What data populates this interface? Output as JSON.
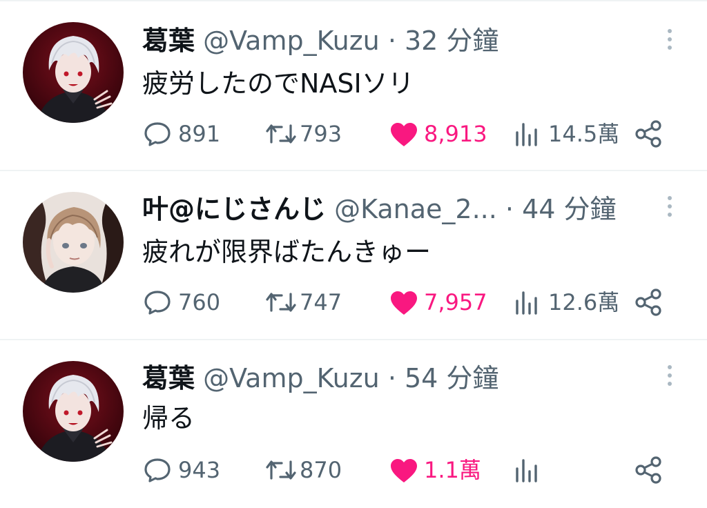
{
  "colors": {
    "like": "#f91880",
    "secondary": "#536471",
    "text": "#0f1419",
    "divider": "#eff3f4"
  },
  "tweets": [
    {
      "display_name": "葛葉",
      "handle": "@Vamp_Kuzu",
      "separator": "·",
      "time": "32 分鐘",
      "text": "疲労したのでNASIソリ",
      "replies": "891",
      "retweets": "793",
      "likes": "8,913",
      "views": "14.5萬",
      "avatar": "silver-hair-avatar"
    },
    {
      "display_name": "叶@にじさんじ",
      "handle": "@Kanae_2...",
      "separator": "·",
      "time": "44 分鐘",
      "text": "疲れが限界ばたんきゅー",
      "replies": "760",
      "retweets": "747",
      "likes": "7,957",
      "views": "12.6萬",
      "avatar": "brown-hair-avatar"
    },
    {
      "display_name": "葛葉",
      "handle": "@Vamp_Kuzu",
      "separator": "·",
      "time": "54 分鐘",
      "text": "帰る",
      "replies": "943",
      "retweets": "870",
      "likes": "1.1萬",
      "views": "",
      "avatar": "silver-hair-avatar"
    }
  ],
  "icons": {
    "reply": "reply-icon",
    "retweet": "retweet-icon",
    "like": "heart-icon",
    "views": "views-icon",
    "share": "share-icon",
    "more": "more-icon"
  }
}
